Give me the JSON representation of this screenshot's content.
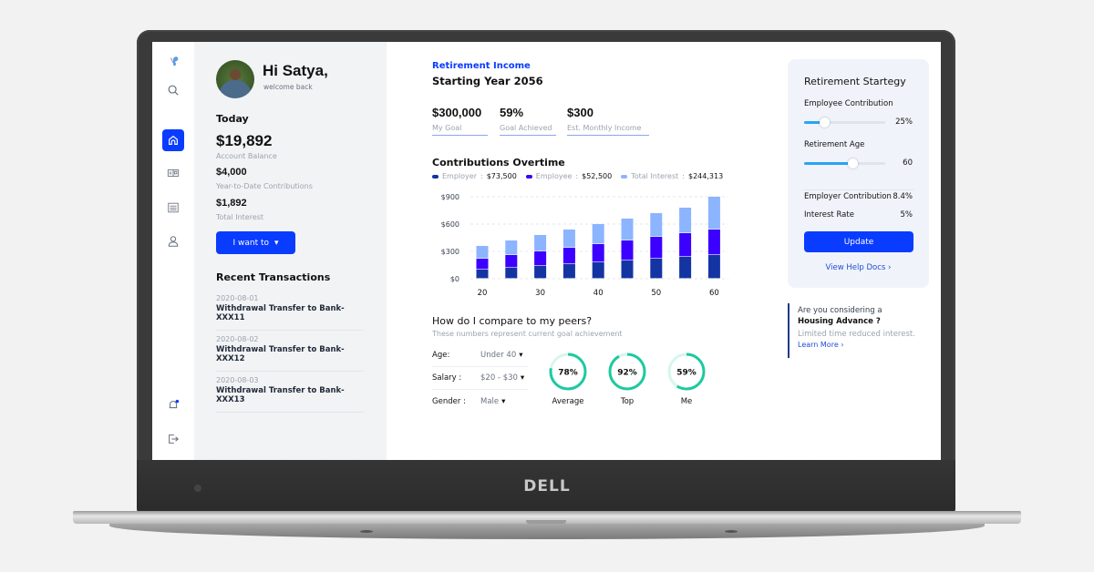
{
  "device": {
    "brand_logo": "DELL"
  },
  "iconbar": {
    "items": [
      {
        "name": "logo",
        "icon": "butterfly-icon"
      },
      {
        "name": "search",
        "icon": "search-icon"
      },
      {
        "name": "home",
        "icon": "home-icon",
        "active": true
      },
      {
        "name": "cards",
        "icon": "id-card-icon"
      },
      {
        "name": "list",
        "icon": "list-icon"
      },
      {
        "name": "profile",
        "icon": "user-icon"
      },
      {
        "name": "notifications",
        "icon": "bell-icon",
        "badge": true
      },
      {
        "name": "logout",
        "icon": "logout-icon"
      }
    ]
  },
  "profile": {
    "greeting": "Hi Satya,",
    "subtitle": "welcome back"
  },
  "today": {
    "heading": "Today",
    "balance": "$19,892",
    "balance_label": "Account Balance",
    "ytd": "$4,000",
    "ytd_label": "Year-to-Date Contributions",
    "interest": "$1,892",
    "interest_label": "Total Interest",
    "action_button": "I want to",
    "action_caret": "▾"
  },
  "transactions": {
    "heading": "Recent Transactions",
    "items": [
      {
        "date": "2020-08-01",
        "desc": "Withdrawal Transfer to Bank-XXX11"
      },
      {
        "date": "2020-08-02",
        "desc": "Withdrawal Transfer to Bank-XXX12"
      },
      {
        "date": "2020-08-03",
        "desc": "Withdrawal Transfer to Bank-XXX13"
      }
    ]
  },
  "retirement": {
    "label": "Retirement Income",
    "title": "Starting Year 2056",
    "stats": [
      {
        "value": "$300,000",
        "label": "My Goal"
      },
      {
        "value": "59%",
        "label": "Goal Achieved"
      },
      {
        "value": "$300",
        "label": "Est. Monthly Income"
      }
    ]
  },
  "chart_data": {
    "type": "bar",
    "stacked": true,
    "title": "Contributions Overtime",
    "xlabel": "",
    "ylabel": "",
    "x": [
      20,
      25,
      30,
      35,
      40,
      45,
      50,
      55,
      60
    ],
    "x_tick_labels": [
      "20",
      "30",
      "40",
      "50",
      "60"
    ],
    "y_ticks": [
      0,
      300,
      600,
      900
    ],
    "y_tick_labels": [
      "$0",
      "$300",
      "$600",
      "$900"
    ],
    "ylim": [
      0,
      900
    ],
    "grid": true,
    "legend_position": "top-left",
    "series": [
      {
        "name": "Employer",
        "total_label": "$73,500",
        "color": "#1434a4",
        "values": [
          100,
          120,
          140,
          160,
          180,
          200,
          220,
          240,
          260
        ]
      },
      {
        "name": "Employee",
        "total_label": "$52,500",
        "color": "#3b00ff",
        "values": [
          120,
          140,
          160,
          180,
          200,
          220,
          240,
          260,
          280
        ]
      },
      {
        "name": "Total Interest",
        "total_label": "$244,313",
        "color": "#8cb4ff",
        "values": [
          140,
          160,
          180,
          200,
          220,
          240,
          260,
          280,
          360
        ]
      }
    ]
  },
  "peers": {
    "title": "How do I compare to my peers?",
    "subtitle": "These numbers represent current goal achievement",
    "filters": [
      {
        "label": "Age:",
        "value": "Under 40"
      },
      {
        "label": "Salary :",
        "value": "$20 - $30"
      },
      {
        "label": "Gender :",
        "value": "Male"
      }
    ],
    "caret": "▾",
    "gauges": [
      {
        "label": "Average",
        "percent": 78,
        "text": "78%"
      },
      {
        "label": "Top",
        "percent": 92,
        "text": "92%"
      },
      {
        "label": "Me",
        "percent": 59,
        "text": "59%"
      }
    ],
    "gauge_color": "#1ec9a0",
    "gauge_track": "#d6f6ee"
  },
  "strategy": {
    "title": "Retirement Startegy",
    "employee_contribution_label": "Employee Contribution",
    "employee_contribution_value": "25%",
    "employee_contribution_fraction": 0.25,
    "retirement_age_label": "Retirement Age",
    "retirement_age_value": "60",
    "retirement_age_fraction": 0.6,
    "employer_contribution_label": "Employer Contribution",
    "employer_contribution_value": "8.4%",
    "interest_rate_label": "Interest Rate",
    "interest_rate_value": "5%",
    "update_button": "Update",
    "help_link": "View Help Docs ›"
  },
  "promo": {
    "line1": "Are you considering a",
    "line2": "Housing Advance ?",
    "line3": "Limited time reduced interest.",
    "link": "Learn More ›"
  }
}
